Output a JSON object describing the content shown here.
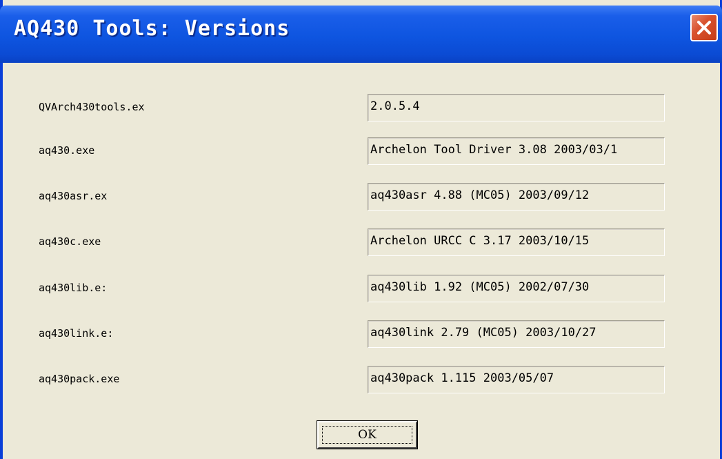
{
  "window": {
    "title": "AQ430 Tools: Versions"
  },
  "rows": [
    {
      "label": "QVArch430tools.ex",
      "value": "2.0.5.4"
    },
    {
      "label": "aq430.exe",
      "value": "Archelon Tool Driver 3.08 2003/03/1"
    },
    {
      "label": "aq430asr.ex",
      "value": "aq430asr 4.88 (MC05) 2003/09/12"
    },
    {
      "label": "aq430c.exe",
      "value": "Archelon URCC C 3.17 2003/10/15"
    },
    {
      "label": "aq430lib.e:",
      "value": "aq430lib 1.92 (MC05) 2002/07/30"
    },
    {
      "label": "aq430link.e:",
      "value": "aq430link 2.79 (MC05) 2003/10/27"
    },
    {
      "label": "aq430pack.exe",
      "value": "aq430pack 1.115 2003/05/07"
    }
  ],
  "buttons": {
    "ok_label": "OK"
  },
  "icons": {
    "close": "close-icon"
  },
  "colors": {
    "titlebar": "#0b4bd4",
    "window_bg": "#ece9d8",
    "close_button": "#d9532f"
  }
}
